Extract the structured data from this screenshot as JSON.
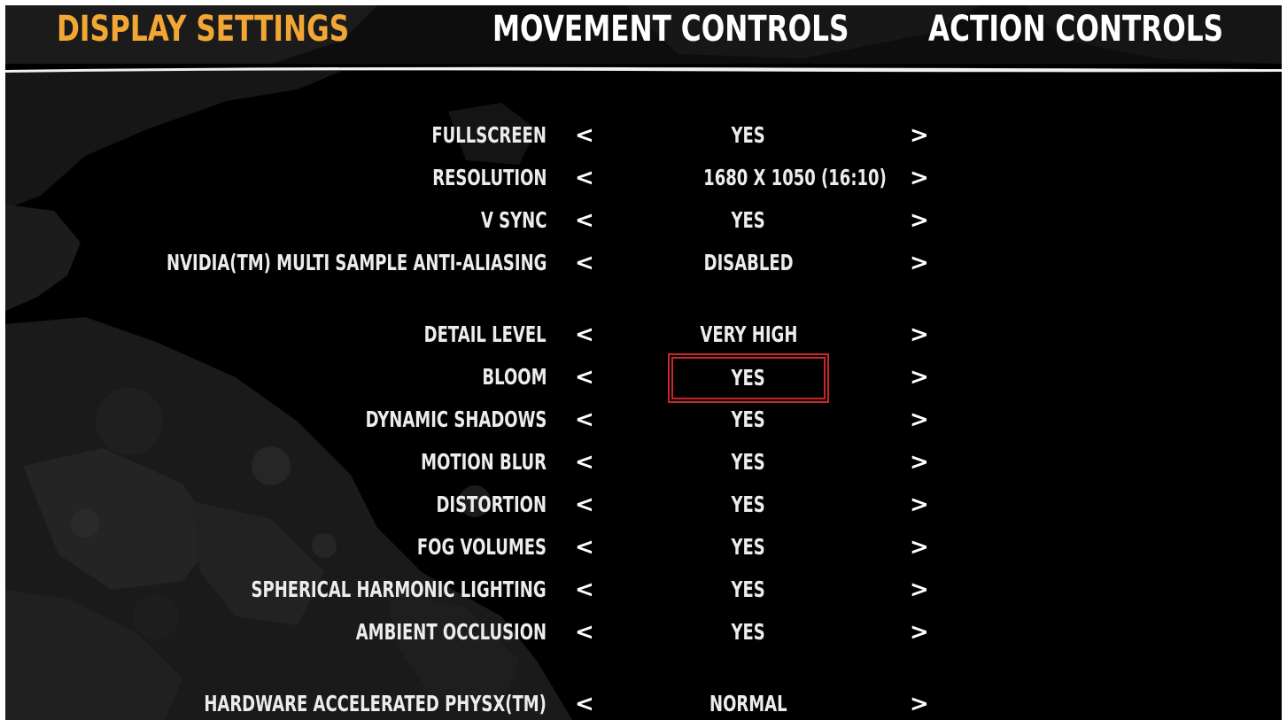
{
  "tabs": [
    {
      "label": "DISPLAY SETTINGS",
      "active": true
    },
    {
      "label": "MOVEMENT CONTROLS",
      "active": false
    },
    {
      "label": "ACTION CONTROLS",
      "active": false
    }
  ],
  "arrows": {
    "left": "<",
    "right": ">"
  },
  "settings": [
    {
      "label": "FULLSCREEN",
      "value": "YES"
    },
    {
      "label": "RESOLUTION",
      "value": "1680 X 1050 (16:10)"
    },
    {
      "label": "V SYNC",
      "value": "YES"
    },
    {
      "label": "NVIDIA(TM) MULTI SAMPLE ANTI-ALIASING",
      "value": "DISABLED"
    },
    {
      "label": "DETAIL LEVEL",
      "value": "VERY HIGH"
    },
    {
      "label": "BLOOM",
      "value": "YES",
      "selected": true
    },
    {
      "label": "DYNAMIC SHADOWS",
      "value": "YES"
    },
    {
      "label": "MOTION BLUR",
      "value": "YES"
    },
    {
      "label": "DISTORTION",
      "value": "YES"
    },
    {
      "label": "FOG VOLUMES",
      "value": "YES"
    },
    {
      "label": "SPHERICAL HARMONIC LIGHTING",
      "value": "YES"
    },
    {
      "label": "AMBIENT OCCLUSION",
      "value": "YES"
    },
    {
      "label": "HARDWARE ACCELERATED PHYSX(TM)",
      "value": "NORMAL"
    }
  ],
  "colors": {
    "active_tab": "#f2a735",
    "inactive_tab": "#ffffff",
    "selection_border": "#c8262b",
    "background": "#000000"
  }
}
